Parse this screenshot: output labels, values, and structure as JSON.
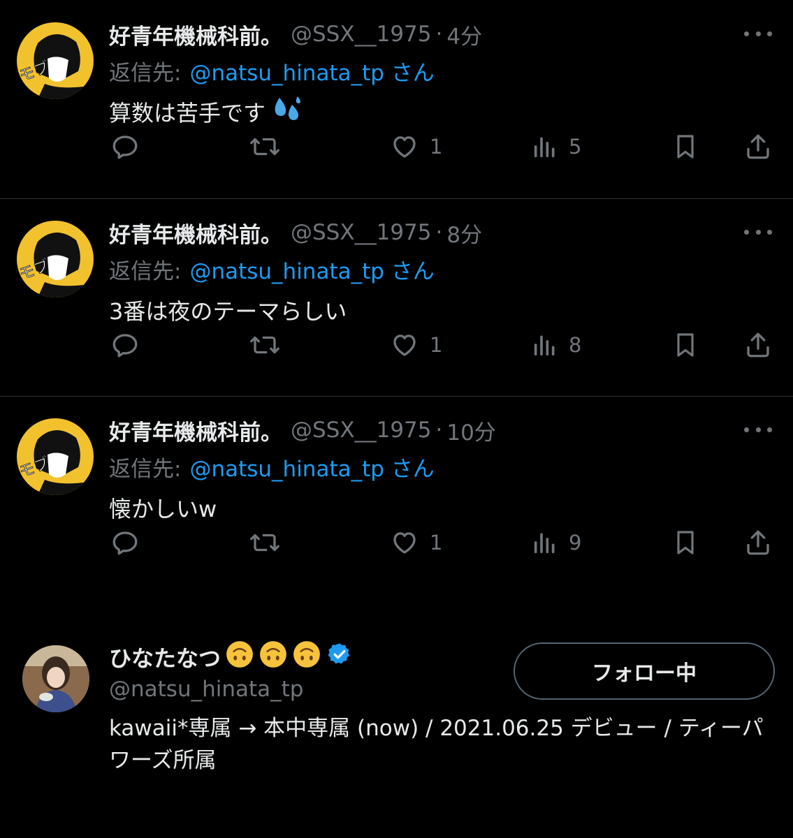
{
  "tweets": [
    {
      "display_name": "好青年機械科前。",
      "handle": "@SSX__1975",
      "separator": "·",
      "time": "4分",
      "reply_label": "返信先:",
      "reply_target": "@natsu_hinata_tp さん",
      "text": "算数は苦手です",
      "emoji": "sweat-droplets",
      "replies": "",
      "retweets": "",
      "likes": "1",
      "views": "5",
      "avatar_text": "モブ"
    },
    {
      "display_name": "好青年機械科前。",
      "handle": "@SSX__1975",
      "separator": "·",
      "time": "8分",
      "reply_label": "返信先:",
      "reply_target": "@natsu_hinata_tp さん",
      "text": "3番は夜のテーマらしい",
      "replies": "",
      "retweets": "",
      "likes": "1",
      "views": "8",
      "avatar_text": "モブ"
    },
    {
      "display_name": "好青年機械科前。",
      "handle": "@SSX__1975",
      "separator": "·",
      "time": "10分",
      "reply_label": "返信先:",
      "reply_target": "@natsu_hinata_tp さん",
      "text": "懐かしいw",
      "replies": "",
      "retweets": "",
      "likes": "1",
      "views": "9",
      "avatar_text": "モブ"
    }
  ],
  "profile": {
    "display_name": "ひなたなつ",
    "emojis": [
      "upside-down-face",
      "upside-down-face",
      "upside-down-face"
    ],
    "verified": true,
    "handle": "@natsu_hinata_tp",
    "follow_label": "フォロー中",
    "bio": "kawaii*専属 → 本中専属 (now) / 2021.06.25 デビュー / ティーパワーズ所属"
  },
  "icons": [
    "reply-icon",
    "retweet-icon",
    "like-icon",
    "views-icon",
    "bookmark-icon",
    "share-icon",
    "more-icon",
    "verified-icon"
  ],
  "colors": {
    "background": "#000000",
    "text": "#e7e9ea",
    "muted": "#71767b",
    "link": "#1d9bf0",
    "verified": "#1d9bf0",
    "avatar_bg": "#f2c12e"
  }
}
